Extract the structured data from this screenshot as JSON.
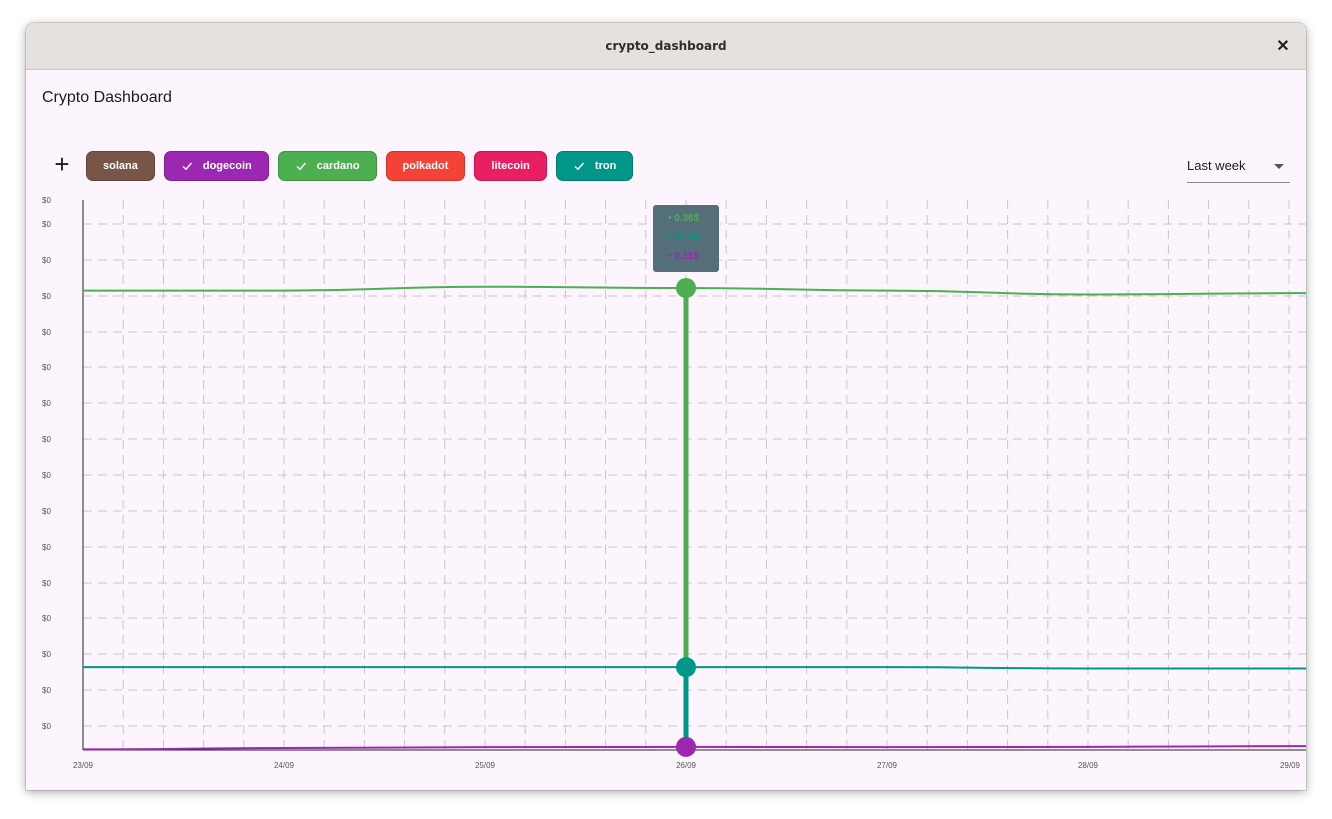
{
  "window": {
    "title": "crypto_dashboard",
    "close_label": "✕"
  },
  "app": {
    "title": "Crypto Dashboard",
    "add_label": "+"
  },
  "chips": [
    {
      "label": "solana",
      "selected": false,
      "color": "#795548"
    },
    {
      "label": "dogecoin",
      "selected": true,
      "color": "#9c27b0"
    },
    {
      "label": "cardano",
      "selected": true,
      "color": "#4caf50"
    },
    {
      "label": "polkadot",
      "selected": false,
      "color": "#f44336"
    },
    {
      "label": "litecoin",
      "selected": false,
      "color": "#e91e63"
    },
    {
      "label": "tron",
      "selected": true,
      "color": "#009688"
    }
  ],
  "range_select": {
    "value": "Last week"
  },
  "tooltip": [
    {
      "text": "• 0.36$",
      "color": "#4caf50"
    },
    {
      "text": "• 0.11$",
      "color": "#009688"
    },
    {
      "text": "• 0.11$",
      "color": "#9c27b0"
    }
  ],
  "chart_data": {
    "type": "line",
    "x": [
      "23/09",
      "24/09",
      "25/09",
      "26/09",
      "27/09",
      "28/09",
      "29/09"
    ],
    "y_tick_labels": [
      "$0",
      "$0",
      "$0",
      "$0",
      "$0",
      "$0",
      "$0",
      "$0",
      "$0",
      "$0",
      "$0",
      "$0",
      "$0",
      "$0",
      "$0",
      "$0"
    ],
    "ylim": [
      0,
      0.425
    ],
    "grid": true,
    "highlight_x": "26/09",
    "series": [
      {
        "name": "cardano",
        "color": "#4caf50",
        "values": [
          0.355,
          0.355,
          0.358,
          0.357,
          0.355,
          0.352,
          0.353
        ]
      },
      {
        "name": "tron",
        "color": "#009688",
        "values": [
          0.064,
          0.064,
          0.064,
          0.064,
          0.064,
          0.063,
          0.063
        ]
      },
      {
        "name": "dogecoin",
        "color": "#9c27b0",
        "values": [
          0.0005,
          0.0015,
          0.0022,
          0.0024,
          0.0022,
          0.0024,
          0.003
        ]
      }
    ]
  }
}
